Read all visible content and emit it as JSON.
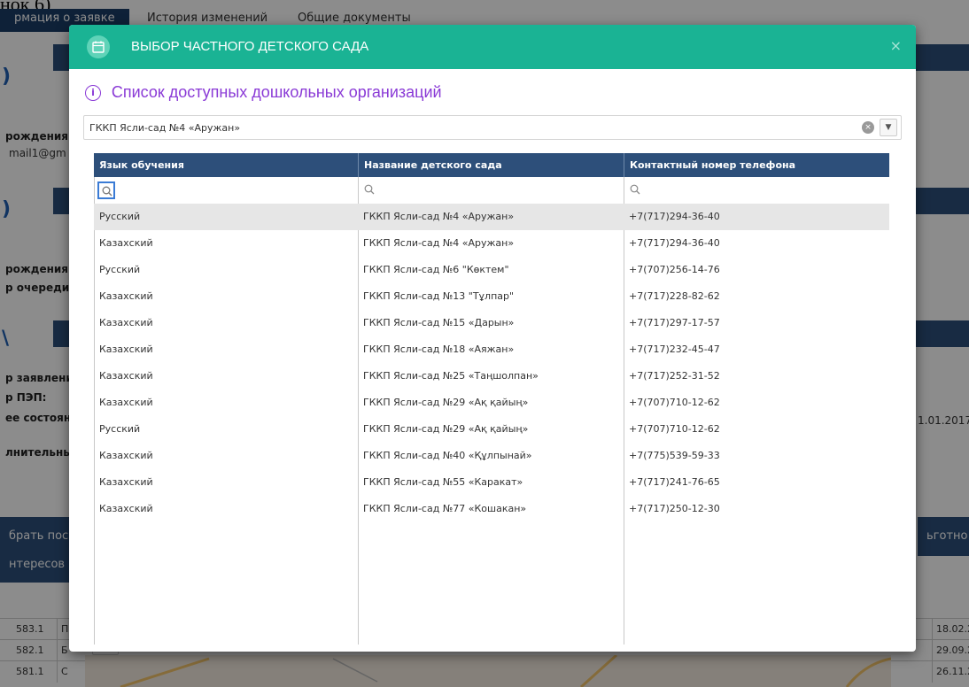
{
  "background": {
    "caption": "нок 6)",
    "tabs": [
      {
        "label": "рмация о заявке",
        "active": true
      },
      {
        "label": "История изменений",
        "active": false
      },
      {
        "label": "Общие документы",
        "active": false
      }
    ],
    "labels": {
      "birth1": "рождения:",
      "email": "mail1@gm",
      "birth2": "рождения:",
      "queue": "р очереди",
      "application": "р заявлени",
      "pep": "р ПЭП:",
      "status": "ее состоян",
      "extra": "лнительны",
      "date_right": "1.01.2017"
    },
    "buttons": {
      "choose": "брать пос",
      "interests": "нтересов",
      "benefits": "ьготно"
    },
    "bottom_rows": [
      {
        "num": "583.1",
        "letter": "П",
        "date": "18.02.2"
      },
      {
        "num": "582.1",
        "letter": "Б",
        "date": "29.09.2"
      },
      {
        "num": "581.1",
        "letter": "С",
        "date": "26.11.2"
      }
    ],
    "zoom_out": "−"
  },
  "modal": {
    "title": "ВЫБОР ЧАСТНОГО ДЕТСКОГО САДА",
    "close_symbol": "×",
    "header_icon": "calendar-icon",
    "list_title": "Список доступных дошкольных организаций",
    "info_symbol": "i",
    "select": {
      "value": "ГККП Ясли-сад  №4 «Аружан»",
      "clear_symbol": "×",
      "arrow_symbol": "▼"
    },
    "grid": {
      "columns": [
        "Язык обучения",
        "Название детского сада",
        "Контактный номер телефона"
      ],
      "rows": [
        {
          "lang": "Русский",
          "name": "ГККП Ясли-сад №4 «Аружан»",
          "phone": "+7(717)294-36-40",
          "selected": true
        },
        {
          "lang": "Казахский",
          "name": "ГККП Ясли-сад №4 «Аружан»",
          "phone": "+7(717)294-36-40"
        },
        {
          "lang": "Русский",
          "name": "ГККП Ясли-сад №6 \"Көктем\"",
          "phone": "+7(707)256-14-76"
        },
        {
          "lang": "Казахский",
          "name": "ГККП Ясли-сад №13 \"Тұлпар\"",
          "phone": "+7(717)228-82-62"
        },
        {
          "lang": "Казахский",
          "name": "ГККП Ясли-сад №15 «Дарын»",
          "phone": "+7(717)297-17-57"
        },
        {
          "lang": "Казахский",
          "name": "ГККП Ясли-сад №18 «Аяжан»",
          "phone": "+7(717)232-45-47"
        },
        {
          "lang": "Казахский",
          "name": "ГККП Ясли-сад №25 «Таңшолпан»",
          "phone": "+7(717)252-31-52"
        },
        {
          "lang": "Казахский",
          "name": "ГККП Ясли-сад №29 «Ақ қайың»",
          "phone": "+7(707)710-12-62"
        },
        {
          "lang": "Русский",
          "name": "ГККП Ясли-сад №29 «Ақ қайың»",
          "phone": "+7(707)710-12-62"
        },
        {
          "lang": "Казахский",
          "name": "ГККП Ясли-сад №40 «Құлпынай»",
          "phone": "+7(775)539-59-33"
        },
        {
          "lang": "Казахский",
          "name": "ГККП Ясли-сад №55 «Каракат»",
          "phone": "+7(717)241-76-65"
        },
        {
          "lang": "Казахский",
          "name": "ГККП Ясли-сад №77 «Кошакан»",
          "phone": "+7(717)250-12-30"
        }
      ]
    }
  },
  "colors": {
    "header_green": "#1ab394",
    "title_purple": "#8a3ad6",
    "grid_header_navy": "#2d4f7a",
    "selected_row": "#e6e6e6"
  }
}
